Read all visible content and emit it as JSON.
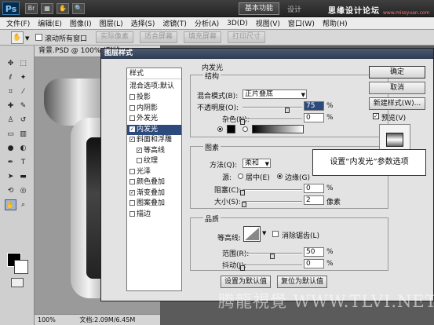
{
  "titlebar": {
    "logo": "Ps",
    "workspace_btn": "基本功能",
    "design_tab": "设计",
    "watermark_brand": "思缘设计论坛",
    "watermark_url": "www.missyuan.com"
  },
  "menu": [
    "文件(F)",
    "编辑(E)",
    "图像(I)",
    "图层(L)",
    "选择(S)",
    "滤镜(T)",
    "分析(A)",
    "3D(D)",
    "视图(V)",
    "窗口(W)",
    "帮助(H)"
  ],
  "options": {
    "scroll_all_label": "滚动所有窗口",
    "btn_actual": "实际像素",
    "btn_fit": "适合屏幕",
    "btn_fill": "填充屏幕",
    "btn_print": "打印尺寸"
  },
  "document": {
    "tab": "背景.PSD @ 100% (形状",
    "zoom": "100%",
    "docsize": "文档:2.09M/6.45M"
  },
  "dialog": {
    "title": "图层样式",
    "styles_header": "样式",
    "blend_options": "混合选项:默认",
    "styles": [
      {
        "label": "投影",
        "checked": false,
        "selected": false
      },
      {
        "label": "内阴影",
        "checked": false,
        "selected": false
      },
      {
        "label": "外发光",
        "checked": false,
        "selected": false
      },
      {
        "label": "内发光",
        "checked": true,
        "selected": true
      },
      {
        "label": "斜面和浮雕",
        "checked": true,
        "selected": false
      },
      {
        "label": "等高线",
        "checked": true,
        "selected": false
      },
      {
        "label": "纹理",
        "checked": false,
        "selected": false
      },
      {
        "label": "光泽",
        "checked": false,
        "selected": false
      },
      {
        "label": "颜色叠加",
        "checked": false,
        "selected": false
      },
      {
        "label": "渐变叠加",
        "checked": true,
        "selected": false
      },
      {
        "label": "图案叠加",
        "checked": false,
        "selected": false
      },
      {
        "label": "描边",
        "checked": false,
        "selected": false
      }
    ],
    "inner_glow_title": "内发光",
    "structure": {
      "title": "结构",
      "blend_mode_label": "混合模式(B):",
      "blend_mode_value": "正片叠底",
      "opacity_label": "不透明度(O):",
      "opacity_value": "75",
      "opacity_level": 75,
      "noise_label": "杂色(N):",
      "noise_value": "0",
      "noise_level": 0,
      "unit": "%"
    },
    "elements": {
      "title": "图素",
      "method_label": "方法(Q):",
      "method_value": "柔和",
      "source_label": "源:",
      "source_center": "居中(E)",
      "source_edge": "边缘(G)",
      "choke_label": "阻塞(C):",
      "choke_value": "0",
      "choke_level": 0,
      "size_label": "大小(S):",
      "size_value": "2",
      "size_level": 2,
      "unit_pct": "%",
      "unit_px": "像素"
    },
    "quality": {
      "title": "品质",
      "contour_label": "等高线:",
      "antialias_label": "消除锯齿(L)",
      "range_label": "范围(R):",
      "range_value": "50",
      "range_level": 50,
      "jitter_label": "抖动(J):",
      "jitter_value": "0",
      "jitter_level": 0,
      "unit": "%"
    },
    "btn_default": "设置为默认值",
    "btn_reset": "复位为默认值",
    "btn_ok": "确定",
    "btn_cancel": "取消",
    "btn_newstyle": "新建样式(W)...",
    "preview_label": "预览(V)"
  },
  "callout": "设置“内发光”参数选项",
  "watermark": "腾龍視覺 WWW.TLVI.NET"
}
